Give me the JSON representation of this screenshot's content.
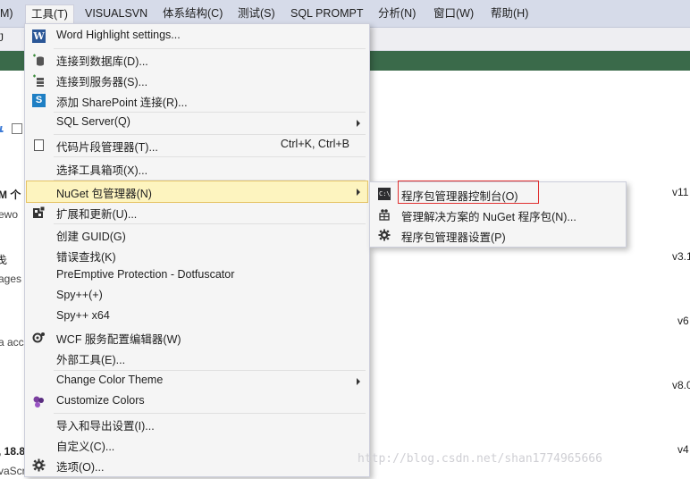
{
  "menubar": {
    "items": [
      {
        "label": "M)"
      },
      {
        "label": "工具(T)"
      },
      {
        "label": "VISUALSVN"
      },
      {
        "label": "体系结构(C)"
      },
      {
        "label": "测试(S)"
      },
      {
        "label": "SQL PROMPT"
      },
      {
        "label": "分析(N)"
      },
      {
        "label": "窗口(W)"
      },
      {
        "label": "帮助(H)"
      }
    ]
  },
  "toolbar": {
    "left_fragment": "J"
  },
  "background": {
    "frag1": "M 个",
    "frag2": "ewo",
    "frag3": "戋",
    "frag4": "ages",
    "frag5": "a acc",
    "frag6": ", 18.8",
    "frag7": "vaScri",
    "v1": "v11",
    "v2": "v3.1",
    "v3": "v6",
    "v4": "v8.0",
    "v5": "v4"
  },
  "tools_menu": {
    "items": [
      {
        "label": "Word Highlight settings...",
        "icon": "word-icon"
      },
      {
        "label": "连接到数据库(D)...",
        "icon": "database-connect-icon"
      },
      {
        "label": "连接到服务器(S)...",
        "icon": "server-connect-icon"
      },
      {
        "label": "添加 SharePoint 连接(R)...",
        "icon": "sharepoint-icon"
      },
      {
        "label": "SQL Server(Q)"
      },
      {
        "label": "代码片段管理器(T)...",
        "shortcut": "Ctrl+K, Ctrl+B",
        "icon": "snippet-icon"
      },
      {
        "label": "选择工具箱项(X)..."
      },
      {
        "label": "NuGet 包管理器(N)"
      },
      {
        "label": "扩展和更新(U)...",
        "icon": "extensions-icon"
      },
      {
        "label": "创建 GUID(G)"
      },
      {
        "label": "错误查找(K)"
      },
      {
        "label": "PreEmptive Protection - Dotfuscator"
      },
      {
        "label": "Spy++(+)"
      },
      {
        "label": "Spy++ x64"
      },
      {
        "label": "WCF 服务配置编辑器(W)",
        "icon": "wcf-icon"
      },
      {
        "label": "外部工具(E)..."
      },
      {
        "label": "Change Color Theme"
      },
      {
        "label": "Customize Colors",
        "icon": "colors-icon"
      },
      {
        "label": "导入和导出设置(I)..."
      },
      {
        "label": "自定义(C)..."
      },
      {
        "label": "选项(O)...",
        "icon": "gear-icon"
      }
    ]
  },
  "nuget_submenu": {
    "items": [
      {
        "label": "程序包管理器控制台(O)",
        "icon": "console-icon"
      },
      {
        "label": "管理解决方案的 NuGet 程序包(N)...",
        "icon": "nuget-packages-icon"
      },
      {
        "label": "程序包管理器设置(P)",
        "icon": "gear-icon"
      }
    ]
  },
  "watermark": "http://blog.csdn.net/shan1774965666"
}
